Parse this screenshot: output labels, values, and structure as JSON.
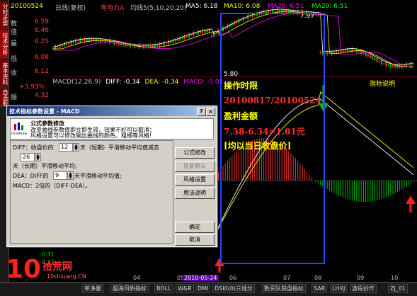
{
  "header": {
    "period": "日线(复权)",
    "stock": "粤电力A",
    "ma_label": "均线5(5,10,20,20)",
    "ma5": "MA5: 6.18",
    "ma10": "MA10: 6.08",
    "ma20": "MA20: 6.51",
    "ma20b": "MA20: 6.51",
    "top_date": "20100524"
  },
  "price_marks": {
    "high": "7.97",
    "low": "5.80"
  },
  "left_rail": [
    "分时走势",
    "技术分析",
    "基本资料",
    "自选股"
  ],
  "quote": {
    "rows": [
      {
        "label": "数",
        "value": "6.59"
      },
      {
        "label": "值",
        "value": "6.46"
      },
      {
        "label": "最",
        "value": "6.25"
      },
      {
        "label": "低",
        "value": "6.08"
      },
      {
        "label": "收",
        "value": "6.12"
      },
      {
        "label": "振",
        "value": "4.32"
      }
    ],
    "change": "+3.93%"
  },
  "macd": {
    "label": "MACD(12,26,9)",
    "diff": "DIFF: -0.34",
    "dea": "DEA: -0.34",
    "macd": "MACD: -0.02",
    "help": "指标说明"
  },
  "annotation": {
    "line1": "操作时限",
    "line2": "20100817/20100524",
    "line3": "盈利金额",
    "line4": "7.38-6.34=1.01元",
    "line5": "[均以当日收盘价]"
  },
  "dialog": {
    "title": "技术指标参数设置 - MACD",
    "section_title": "公式参数修改",
    "desc1": "改变曲线参数值即立即生效，效果不好可以取消；",
    "desc2": "风格设置可以修改输出曲线的颜色、粗细等风格!",
    "icon_label": "ChartPicker",
    "row1_label": "DIFF：收盘价的",
    "row1_value": "12",
    "row1_suffix": "天（短期）平滑移动平均值减去",
    "row2_value": "26",
    "row2_suffix": "天（长期）平滑移动平均;",
    "row3_label": "DEA：DIFF的",
    "row3_value": "9",
    "row3_suffix": "天平滑移动平均值;",
    "row4": "MACD：2倍的（DIFF-DEA）。",
    "btn_formula": "公式修改",
    "btn_restore": "恢复默认",
    "btn_style": "风格设置",
    "btn_help": "用法说明",
    "btn_ok": "确定",
    "btn_cancel": "取消",
    "help_btn": "?",
    "close_btn": "×"
  },
  "axis_dates": [
    "04",
    "05",
    "06",
    "07",
    "08",
    "09",
    "10"
  ],
  "cursor_date": "2010-05-24",
  "left_small_vals": [
    "-0.31",
    "-0.31"
  ],
  "bottom_tabs": [
    "单净量",
    "超海风帆指标",
    "BOLL",
    "W&R",
    "DMI",
    "DSI0(0)三线分",
    "数买队获盘指标",
    "SAR",
    "LHXJ",
    "波段抄作",
    "ZJ_01"
  ],
  "logo": {
    "num": "10",
    "text": "拾荒网",
    "url": "10shiuang.CN"
  },
  "colors": {
    "up": "#ff3030",
    "down": "#00c000",
    "ma5": "#ffffff",
    "ma10": "#ffff00",
    "ma20": "#ff00ff",
    "box": "#1e4bff",
    "annotation": "#ffff00"
  }
}
